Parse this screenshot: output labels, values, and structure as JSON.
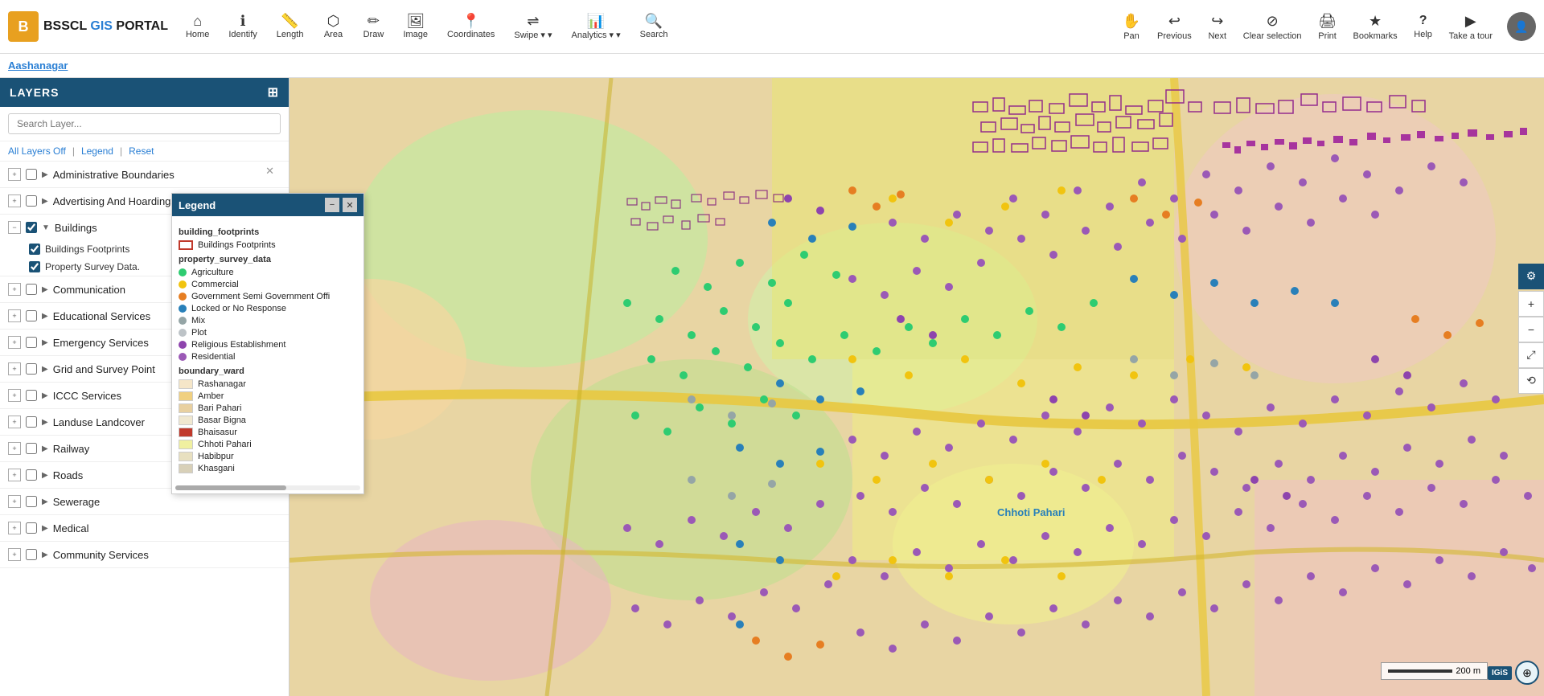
{
  "logo": {
    "icon_letter": "B",
    "title_bsscl": "BSSCL",
    "title_gis": " GIS ",
    "title_portal": "PORTAL"
  },
  "toolbar": {
    "nav_items": [
      {
        "id": "home",
        "icon": "⌂",
        "label": "Home"
      },
      {
        "id": "identify",
        "icon": "ℹ",
        "label": "Identify"
      },
      {
        "id": "length",
        "icon": "📏",
        "label": "Length"
      },
      {
        "id": "area",
        "icon": "⬜",
        "label": "Area"
      },
      {
        "id": "draw",
        "icon": "✏",
        "label": "Draw"
      },
      {
        "id": "image",
        "icon": "🖼",
        "label": "Image"
      },
      {
        "id": "coordinates",
        "icon": "📍",
        "label": "Coordinates"
      },
      {
        "id": "swipe",
        "icon": "↔",
        "label": "Swipe",
        "arrow": true
      },
      {
        "id": "analytics",
        "icon": "📈",
        "label": "Analytics",
        "arrow": true
      },
      {
        "id": "search",
        "icon": "🔍",
        "label": "Search"
      }
    ],
    "right_tools": [
      {
        "id": "pan",
        "icon": "✋",
        "label": "Pan"
      },
      {
        "id": "previous",
        "icon": "↩",
        "label": "Previous"
      },
      {
        "id": "next",
        "icon": "↪",
        "label": "Next"
      },
      {
        "id": "clear-selection",
        "icon": "⊘",
        "label": "Clear selection"
      },
      {
        "id": "print",
        "icon": "🖨",
        "label": "Print"
      },
      {
        "id": "bookmarks",
        "icon": "★",
        "label": "Bookmarks"
      },
      {
        "id": "help",
        "icon": "?",
        "label": "Help"
      },
      {
        "id": "take-a-tour",
        "icon": "▶",
        "label": "Take a tour"
      }
    ]
  },
  "address_bar": {
    "location": "Aashanagar"
  },
  "sidebar": {
    "title": "LAYERS",
    "search_placeholder": "Search Layer...",
    "controls": [
      {
        "id": "all-layers-off",
        "label": "All Layers Off"
      },
      {
        "id": "legend",
        "label": "Legend"
      },
      {
        "id": "reset",
        "label": "Reset"
      }
    ],
    "layer_groups": [
      {
        "id": "admin-boundaries",
        "name": "Administrative Boundaries",
        "expanded": false,
        "checked": false
      },
      {
        "id": "advertising-hoardings",
        "name": "Advertising And Hoardings",
        "expanded": false,
        "checked": false
      },
      {
        "id": "buildings",
        "name": "Buildings",
        "expanded": true,
        "checked": true,
        "sublayers": [
          {
            "id": "buildings-footprints",
            "name": "Buildings Footprints",
            "checked": true
          },
          {
            "id": "property-survey",
            "name": "Property Survey Data.",
            "checked": true
          }
        ]
      },
      {
        "id": "communication",
        "name": "Communication",
        "expanded": false,
        "checked": false
      },
      {
        "id": "educational-services",
        "name": "Educational Services",
        "expanded": false,
        "checked": false
      },
      {
        "id": "emergency-services",
        "name": "Emergency Services",
        "expanded": false,
        "checked": false
      },
      {
        "id": "grid-survey",
        "name": "Grid and Survey Point",
        "expanded": false,
        "checked": false
      },
      {
        "id": "iccc-services",
        "name": "ICCC Services",
        "expanded": false,
        "checked": false
      },
      {
        "id": "landuse-landcover",
        "name": "Landuse Landcover",
        "expanded": false,
        "checked": false
      },
      {
        "id": "railway",
        "name": "Railway",
        "expanded": false,
        "checked": false
      },
      {
        "id": "roads",
        "name": "Roads",
        "expanded": false,
        "checked": false
      },
      {
        "id": "sewerage",
        "name": "Sewerage",
        "expanded": false,
        "checked": false
      },
      {
        "id": "medical",
        "name": "Medical",
        "expanded": false,
        "checked": false
      },
      {
        "id": "community-services",
        "name": "Community Services",
        "expanded": false,
        "checked": false
      }
    ]
  },
  "legend": {
    "title": "Legend",
    "section_building_footprints": "building_footprints",
    "building_footprints_label": "Buildings Footprints",
    "section_property_survey": "property_survey_data",
    "property_items": [
      {
        "label": "Agriculture",
        "color": "#2ecc71"
      },
      {
        "label": "Commercial",
        "color": "#f1c40f"
      },
      {
        "label": "Government Semi Government Offi",
        "color": "#e67e22"
      },
      {
        "label": "Locked or No Response",
        "color": "#2980b9"
      },
      {
        "label": "Mix",
        "color": "#95a5a6"
      },
      {
        "label": "Plot",
        "color": "#bdc3c7"
      },
      {
        "label": "Religious Establishment",
        "color": "#8e44ad"
      },
      {
        "label": "Residential",
        "color": "#9b59b6"
      }
    ],
    "section_boundary_ward": "boundary_ward",
    "boundary_items": [
      {
        "label": "Rashanagar",
        "color": "#f5e6c8"
      },
      {
        "label": "Amber",
        "color": "#f0d080"
      },
      {
        "label": "Bari Pahari",
        "color": "#e8d0a0"
      },
      {
        "label": "Basar Bigna",
        "color": "#f0e8d0"
      },
      {
        "label": "Bhaisasur",
        "color": "#c0392b",
        "filled": true
      },
      {
        "label": "Chhoti Pahari",
        "color": "#f0f0a0"
      },
      {
        "label": "Habibpur",
        "color": "#e8e0c0"
      },
      {
        "label": "Khasgani",
        "color": "#d8d0b8"
      }
    ]
  },
  "map": {
    "label_chhoti_pahari": "Chhoti Pahari",
    "scale_text": "200 m"
  },
  "right_panel": {
    "collapse_icon": "❯"
  }
}
